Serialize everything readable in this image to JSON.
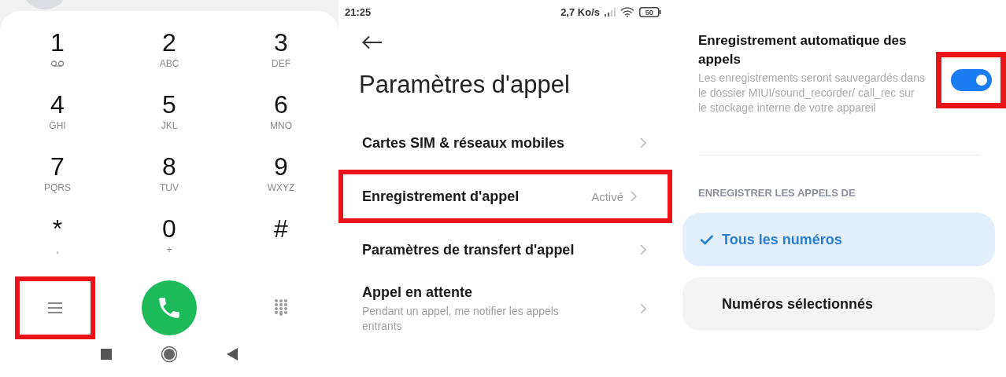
{
  "dialer": {
    "keys": [
      {
        "digit": "1",
        "kind": "voicemail"
      },
      {
        "digit": "2",
        "letters": "ABC",
        "kind": "plain"
      },
      {
        "digit": "3",
        "letters": "DEF",
        "kind": "plain"
      },
      {
        "digit": "4",
        "letters": "GHI",
        "kind": "plain"
      },
      {
        "digit": "5",
        "letters": "JKL",
        "kind": "plain"
      },
      {
        "digit": "6",
        "letters": "MNO",
        "kind": "plain"
      },
      {
        "digit": "7",
        "letters": "PQRS",
        "kind": "plain"
      },
      {
        "digit": "8",
        "letters": "TUV",
        "kind": "plain"
      },
      {
        "digit": "9",
        "letters": "WXYZ",
        "kind": "plain"
      },
      {
        "digit": "*",
        "letters": ",",
        "kind": "plain"
      },
      {
        "digit": "0",
        "letters": "+",
        "kind": "plain"
      },
      {
        "digit": "#",
        "kind": "plain"
      }
    ],
    "menu_button": {
      "highlighted": true
    }
  },
  "call_settings": {
    "status_bar": {
      "time": "21:25",
      "speed": "2,7 Ko/s",
      "battery": "50"
    },
    "title": "Paramètres d'appel",
    "items": [
      {
        "label": "Cartes SIM & réseaux mobiles",
        "highlighted": false
      },
      {
        "label": "Enregistrement d'appel",
        "value": "Activé",
        "highlighted": true
      },
      {
        "label": "Paramètres de transfert d'appel",
        "highlighted": false
      },
      {
        "label": "Appel en attente",
        "description": "Pendant un appel, me notifier les appels entrants",
        "highlighted": false
      }
    ]
  },
  "recording": {
    "auto_record": {
      "title": "Enregistrement automatique des appels",
      "description": "Les enregistrements seront sauvegardés dans le dossier MIUI/sound_recorder/ call_rec sur le stockage interne de votre appareil",
      "on": true,
      "highlighted": true
    },
    "section_header": "ENREGISTRER LES APPELS DE",
    "options": [
      {
        "label": "Tous les numéros",
        "selected": true
      },
      {
        "label": "Numéros sélectionnés",
        "selected": false
      }
    ]
  }
}
